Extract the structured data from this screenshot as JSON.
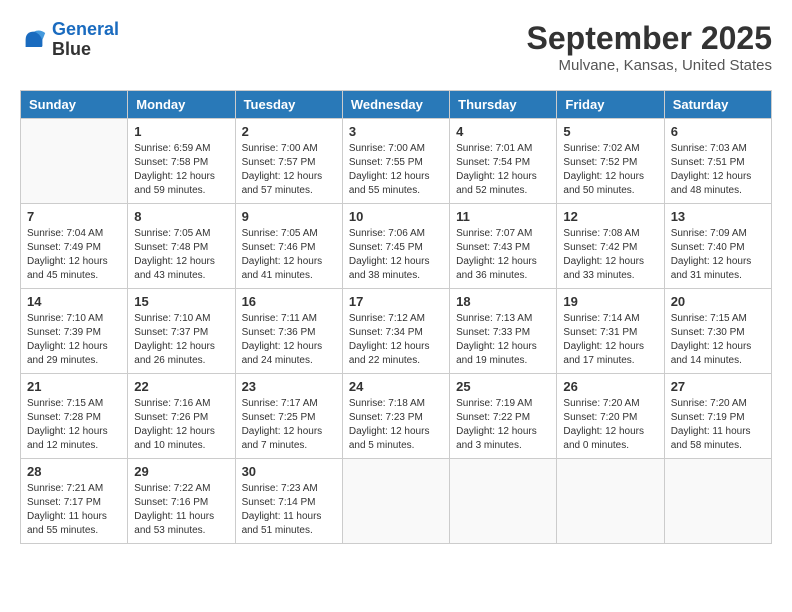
{
  "logo": {
    "line1": "General",
    "line2": "Blue"
  },
  "title": "September 2025",
  "location": "Mulvane, Kansas, United States",
  "days_of_week": [
    "Sunday",
    "Monday",
    "Tuesday",
    "Wednesday",
    "Thursday",
    "Friday",
    "Saturday"
  ],
  "weeks": [
    [
      {
        "day": "",
        "sunrise": "",
        "sunset": "",
        "daylight": ""
      },
      {
        "day": "1",
        "sunrise": "Sunrise: 6:59 AM",
        "sunset": "Sunset: 7:58 PM",
        "daylight": "Daylight: 12 hours and 59 minutes."
      },
      {
        "day": "2",
        "sunrise": "Sunrise: 7:00 AM",
        "sunset": "Sunset: 7:57 PM",
        "daylight": "Daylight: 12 hours and 57 minutes."
      },
      {
        "day": "3",
        "sunrise": "Sunrise: 7:00 AM",
        "sunset": "Sunset: 7:55 PM",
        "daylight": "Daylight: 12 hours and 55 minutes."
      },
      {
        "day": "4",
        "sunrise": "Sunrise: 7:01 AM",
        "sunset": "Sunset: 7:54 PM",
        "daylight": "Daylight: 12 hours and 52 minutes."
      },
      {
        "day": "5",
        "sunrise": "Sunrise: 7:02 AM",
        "sunset": "Sunset: 7:52 PM",
        "daylight": "Daylight: 12 hours and 50 minutes."
      },
      {
        "day": "6",
        "sunrise": "Sunrise: 7:03 AM",
        "sunset": "Sunset: 7:51 PM",
        "daylight": "Daylight: 12 hours and 48 minutes."
      }
    ],
    [
      {
        "day": "7",
        "sunrise": "Sunrise: 7:04 AM",
        "sunset": "Sunset: 7:49 PM",
        "daylight": "Daylight: 12 hours and 45 minutes."
      },
      {
        "day": "8",
        "sunrise": "Sunrise: 7:05 AM",
        "sunset": "Sunset: 7:48 PM",
        "daylight": "Daylight: 12 hours and 43 minutes."
      },
      {
        "day": "9",
        "sunrise": "Sunrise: 7:05 AM",
        "sunset": "Sunset: 7:46 PM",
        "daylight": "Daylight: 12 hours and 41 minutes."
      },
      {
        "day": "10",
        "sunrise": "Sunrise: 7:06 AM",
        "sunset": "Sunset: 7:45 PM",
        "daylight": "Daylight: 12 hours and 38 minutes."
      },
      {
        "day": "11",
        "sunrise": "Sunrise: 7:07 AM",
        "sunset": "Sunset: 7:43 PM",
        "daylight": "Daylight: 12 hours and 36 minutes."
      },
      {
        "day": "12",
        "sunrise": "Sunrise: 7:08 AM",
        "sunset": "Sunset: 7:42 PM",
        "daylight": "Daylight: 12 hours and 33 minutes."
      },
      {
        "day": "13",
        "sunrise": "Sunrise: 7:09 AM",
        "sunset": "Sunset: 7:40 PM",
        "daylight": "Daylight: 12 hours and 31 minutes."
      }
    ],
    [
      {
        "day": "14",
        "sunrise": "Sunrise: 7:10 AM",
        "sunset": "Sunset: 7:39 PM",
        "daylight": "Daylight: 12 hours and 29 minutes."
      },
      {
        "day": "15",
        "sunrise": "Sunrise: 7:10 AM",
        "sunset": "Sunset: 7:37 PM",
        "daylight": "Daylight: 12 hours and 26 minutes."
      },
      {
        "day": "16",
        "sunrise": "Sunrise: 7:11 AM",
        "sunset": "Sunset: 7:36 PM",
        "daylight": "Daylight: 12 hours and 24 minutes."
      },
      {
        "day": "17",
        "sunrise": "Sunrise: 7:12 AM",
        "sunset": "Sunset: 7:34 PM",
        "daylight": "Daylight: 12 hours and 22 minutes."
      },
      {
        "day": "18",
        "sunrise": "Sunrise: 7:13 AM",
        "sunset": "Sunset: 7:33 PM",
        "daylight": "Daylight: 12 hours and 19 minutes."
      },
      {
        "day": "19",
        "sunrise": "Sunrise: 7:14 AM",
        "sunset": "Sunset: 7:31 PM",
        "daylight": "Daylight: 12 hours and 17 minutes."
      },
      {
        "day": "20",
        "sunrise": "Sunrise: 7:15 AM",
        "sunset": "Sunset: 7:30 PM",
        "daylight": "Daylight: 12 hours and 14 minutes."
      }
    ],
    [
      {
        "day": "21",
        "sunrise": "Sunrise: 7:15 AM",
        "sunset": "Sunset: 7:28 PM",
        "daylight": "Daylight: 12 hours and 12 minutes."
      },
      {
        "day": "22",
        "sunrise": "Sunrise: 7:16 AM",
        "sunset": "Sunset: 7:26 PM",
        "daylight": "Daylight: 12 hours and 10 minutes."
      },
      {
        "day": "23",
        "sunrise": "Sunrise: 7:17 AM",
        "sunset": "Sunset: 7:25 PM",
        "daylight": "Daylight: 12 hours and 7 minutes."
      },
      {
        "day": "24",
        "sunrise": "Sunrise: 7:18 AM",
        "sunset": "Sunset: 7:23 PM",
        "daylight": "Daylight: 12 hours and 5 minutes."
      },
      {
        "day": "25",
        "sunrise": "Sunrise: 7:19 AM",
        "sunset": "Sunset: 7:22 PM",
        "daylight": "Daylight: 12 hours and 3 minutes."
      },
      {
        "day": "26",
        "sunrise": "Sunrise: 7:20 AM",
        "sunset": "Sunset: 7:20 PM",
        "daylight": "Daylight: 12 hours and 0 minutes."
      },
      {
        "day": "27",
        "sunrise": "Sunrise: 7:20 AM",
        "sunset": "Sunset: 7:19 PM",
        "daylight": "Daylight: 11 hours and 58 minutes."
      }
    ],
    [
      {
        "day": "28",
        "sunrise": "Sunrise: 7:21 AM",
        "sunset": "Sunset: 7:17 PM",
        "daylight": "Daylight: 11 hours and 55 minutes."
      },
      {
        "day": "29",
        "sunrise": "Sunrise: 7:22 AM",
        "sunset": "Sunset: 7:16 PM",
        "daylight": "Daylight: 11 hours and 53 minutes."
      },
      {
        "day": "30",
        "sunrise": "Sunrise: 7:23 AM",
        "sunset": "Sunset: 7:14 PM",
        "daylight": "Daylight: 11 hours and 51 minutes."
      },
      {
        "day": "",
        "sunrise": "",
        "sunset": "",
        "daylight": ""
      },
      {
        "day": "",
        "sunrise": "",
        "sunset": "",
        "daylight": ""
      },
      {
        "day": "",
        "sunrise": "",
        "sunset": "",
        "daylight": ""
      },
      {
        "day": "",
        "sunrise": "",
        "sunset": "",
        "daylight": ""
      }
    ]
  ]
}
